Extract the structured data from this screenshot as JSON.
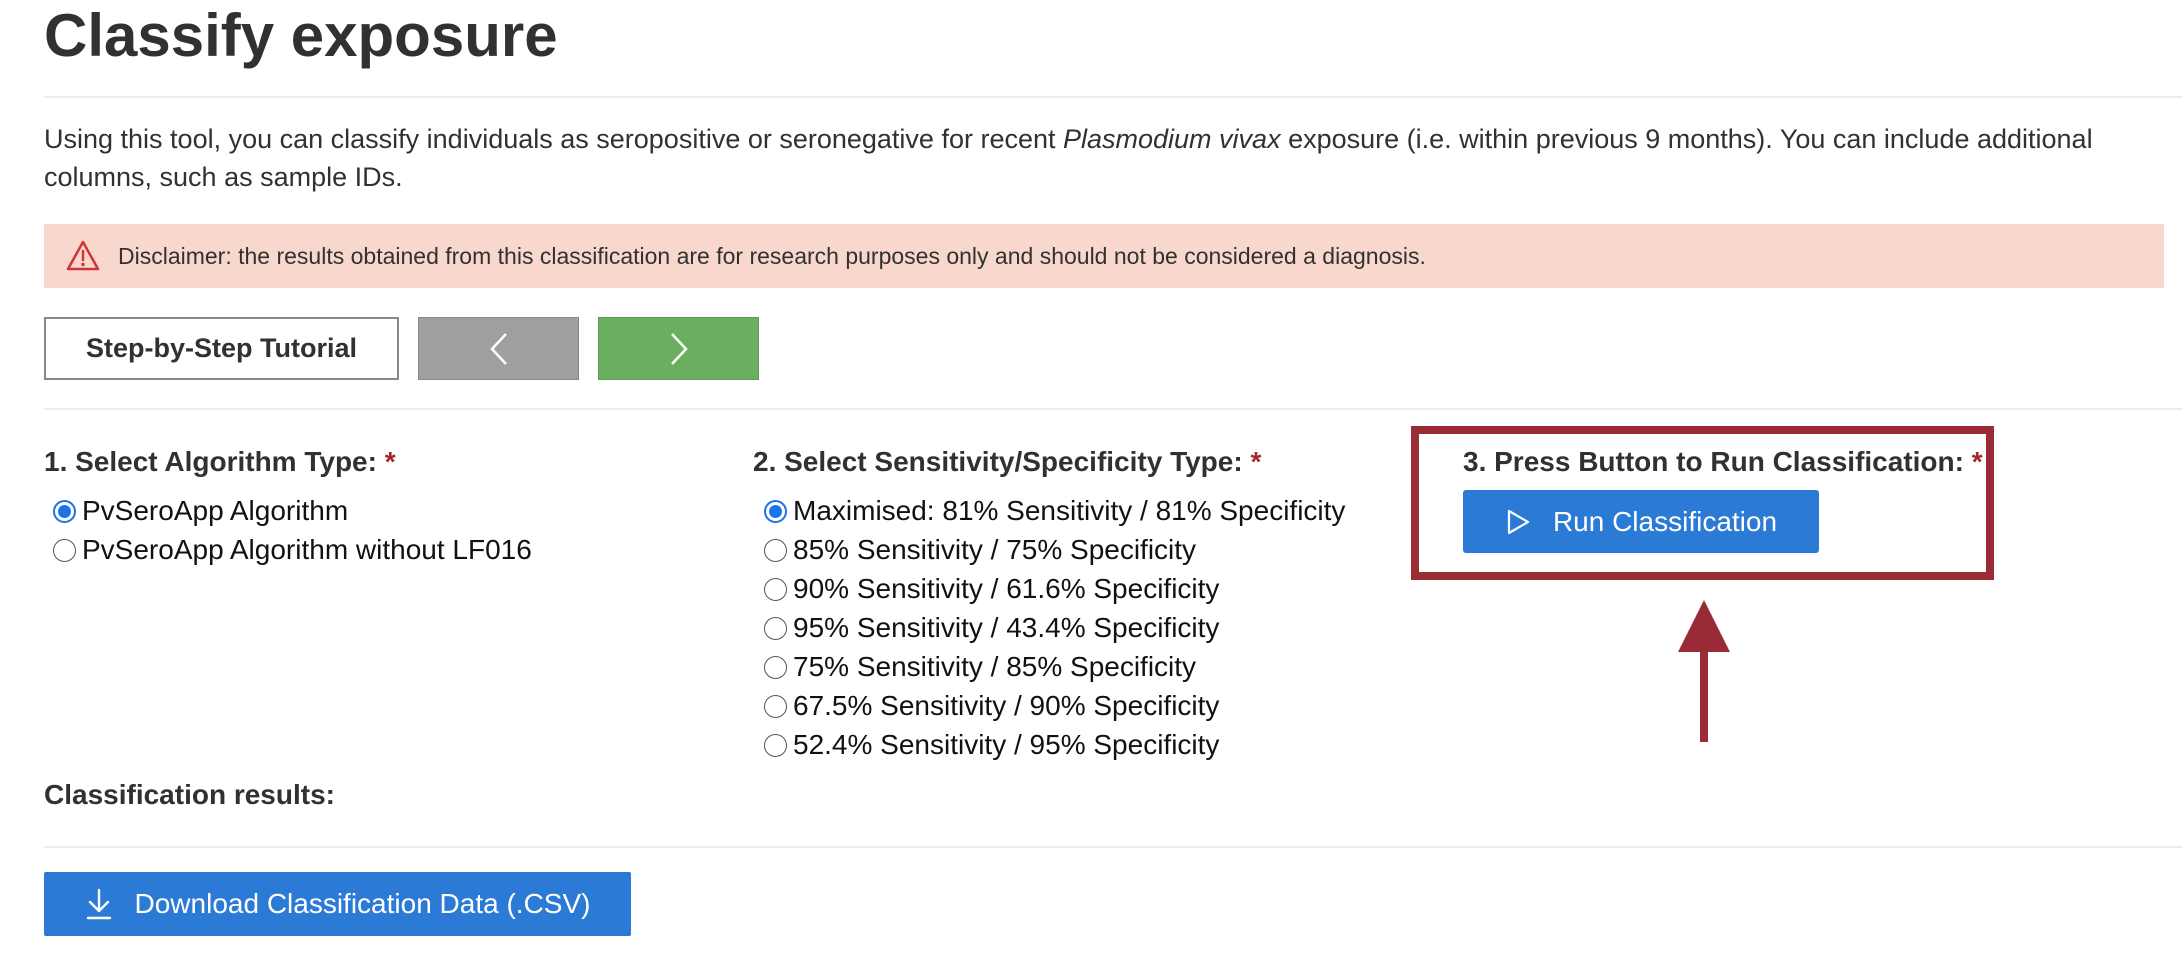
{
  "header": {
    "title": "Classify exposure"
  },
  "intro": {
    "before": "Using this tool, you can classify individuals as seropositive or seronegative for recent ",
    "emphasis": "Plasmodium vivax",
    "after": " exposure (i.e. within previous 9 months). You can include additional columns, such as sample IDs."
  },
  "disclaimer": {
    "icon": "warning-triangle-icon",
    "text": "Disclaimer: the results obtained from this classification are for research purposes only and should not be considered a diagnosis.",
    "background": "#f8d8cd",
    "icon_color": "#d13438"
  },
  "tutorial": {
    "tutorial_label": "Step-by-Step Tutorial",
    "prev_icon": "chevron-left-icon",
    "next_icon": "chevron-right-icon",
    "next_color": "#6aaf5f"
  },
  "algorithm": {
    "label": "1. Select Algorithm Type:",
    "required_mark": "*",
    "options": [
      {
        "label": "PvSeroApp Algorithm",
        "checked": true
      },
      {
        "label": "PvSeroApp Algorithm without LF016",
        "checked": false
      }
    ]
  },
  "sensitivity": {
    "label": "2. Select Sensitivity/Specificity Type:",
    "required_mark": "*",
    "options": [
      {
        "label": "Maximised: 81% Sensitivity / 81% Specificity",
        "checked": true
      },
      {
        "label": "85% Sensitivity / 75% Specificity",
        "checked": false
      },
      {
        "label": "90% Sensitivity / 61.6% Specificity",
        "checked": false
      },
      {
        "label": "95% Sensitivity / 43.4% Specificity",
        "checked": false
      },
      {
        "label": "75% Sensitivity / 85% Specificity",
        "checked": false
      },
      {
        "label": "67.5% Sensitivity / 90% Specificity",
        "checked": false
      },
      {
        "label": "52.4% Sensitivity / 95% Specificity",
        "checked": false
      }
    ]
  },
  "run": {
    "label": "3. Press Button to Run Classification:",
    "required_mark": "*",
    "button_label": "Run Classification",
    "button_icon": "play-icon",
    "button_color": "#2b7ad6",
    "highlight_color": "#9a2c35"
  },
  "results": {
    "label": "Classification results:",
    "download_label": "Download Classification Data (.CSV)",
    "download_icon": "download-icon"
  }
}
